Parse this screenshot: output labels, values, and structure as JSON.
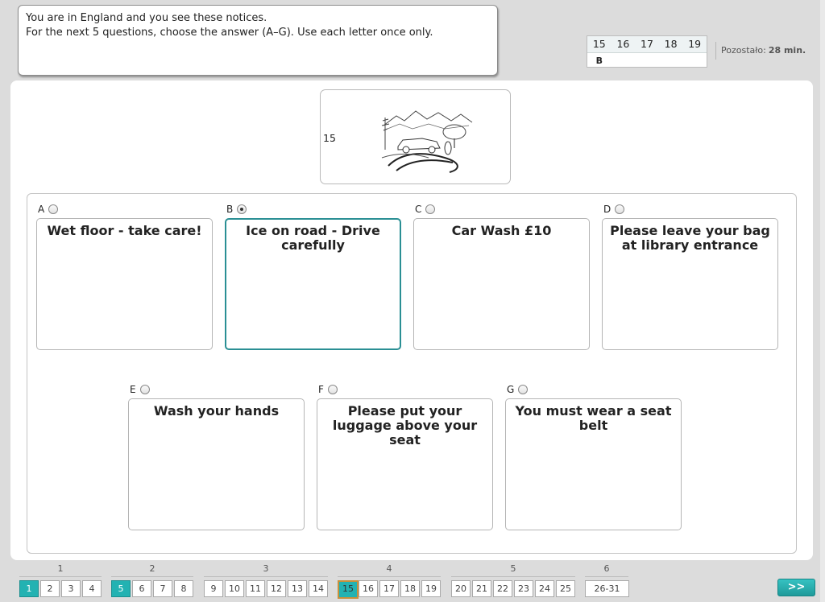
{
  "instructions": {
    "line1": "You are in England and you see these notices.",
    "line2": "For the next 5 questions, choose the answer (A–G). Use each letter once only."
  },
  "answers_table": {
    "headers": [
      "15",
      "16",
      "17",
      "18",
      "19"
    ],
    "values": [
      "B",
      "",
      "",
      "",
      ""
    ]
  },
  "timer": {
    "label": "Pozostało:",
    "value": "28 min."
  },
  "question": {
    "number": "15",
    "image_icon": "road-icy-car-illustration"
  },
  "options": [
    {
      "letter": "A",
      "text": "Wet floor - take care!",
      "selected": false
    },
    {
      "letter": "B",
      "text": "Ice on road - Drive carefully",
      "selected": true
    },
    {
      "letter": "C",
      "text": "Car Wash £10",
      "selected": false
    },
    {
      "letter": "D",
      "text": "Please leave your bag at library entrance",
      "selected": false
    },
    {
      "letter": "E",
      "text": "Wash your hands",
      "selected": false
    },
    {
      "letter": "F",
      "text": "Please put your luggage above your seat",
      "selected": false
    },
    {
      "letter": "G",
      "text": "You must wear a seat belt",
      "selected": false
    }
  ],
  "nav": {
    "groups": [
      "1",
      "2",
      "3",
      "4",
      "5",
      "6"
    ],
    "buttons": [
      "1",
      "2",
      "3",
      "4",
      "5",
      "6",
      "7",
      "8",
      "9",
      "10",
      "11",
      "12",
      "13",
      "14",
      "15",
      "16",
      "17",
      "18",
      "19",
      "20",
      "21",
      "22",
      "23",
      "24",
      "25",
      "26-31"
    ],
    "next_label": ">>"
  },
  "colors": {
    "accent": "#23b2b2",
    "current_border": "#c9903b",
    "selected_border": "#2a8f94"
  }
}
